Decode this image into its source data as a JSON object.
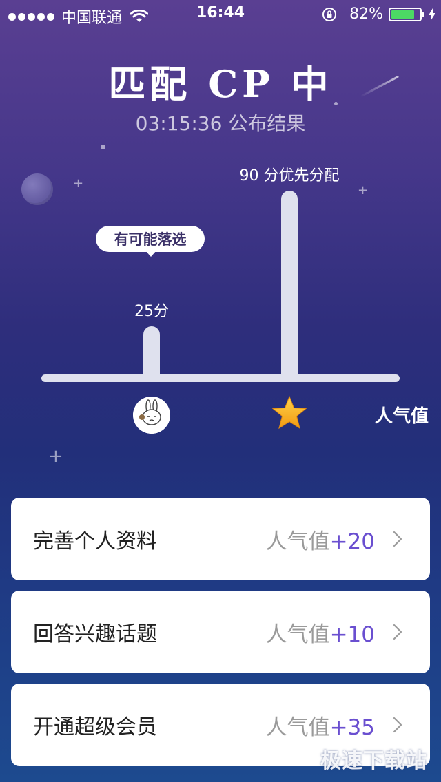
{
  "status_bar": {
    "carrier": "中国联通",
    "time": "16:44",
    "battery_percent": "82%",
    "battery_level": 0.82,
    "battery_color": "#4cd964"
  },
  "header": {
    "title": "匹配 CP 中",
    "subtitle": "03:15:36 公布结果"
  },
  "chart_data": {
    "type": "bar",
    "categories": [
      "avatar",
      "star"
    ],
    "values": [
      25,
      90
    ],
    "data_labels": [
      "25分",
      "90 分优先分配"
    ],
    "callout": "有可能落选",
    "xlabel": "人气值",
    "ylim": [
      0,
      100
    ]
  },
  "tasks": [
    {
      "title": "完善个人资料",
      "reward_label": "人气值",
      "reward_value": "+20"
    },
    {
      "title": "回答兴趣话题",
      "reward_label": "人气值",
      "reward_value": "+10"
    },
    {
      "title": "开通超级会员",
      "reward_label": "人气值",
      "reward_value": "+35"
    }
  ],
  "watermark": "极速下载站",
  "colors": {
    "accent": "#6a4fd0",
    "bar": "#dfe1ee",
    "background_top": "#5a3f92",
    "background_bottom": "#1d4a8f"
  }
}
